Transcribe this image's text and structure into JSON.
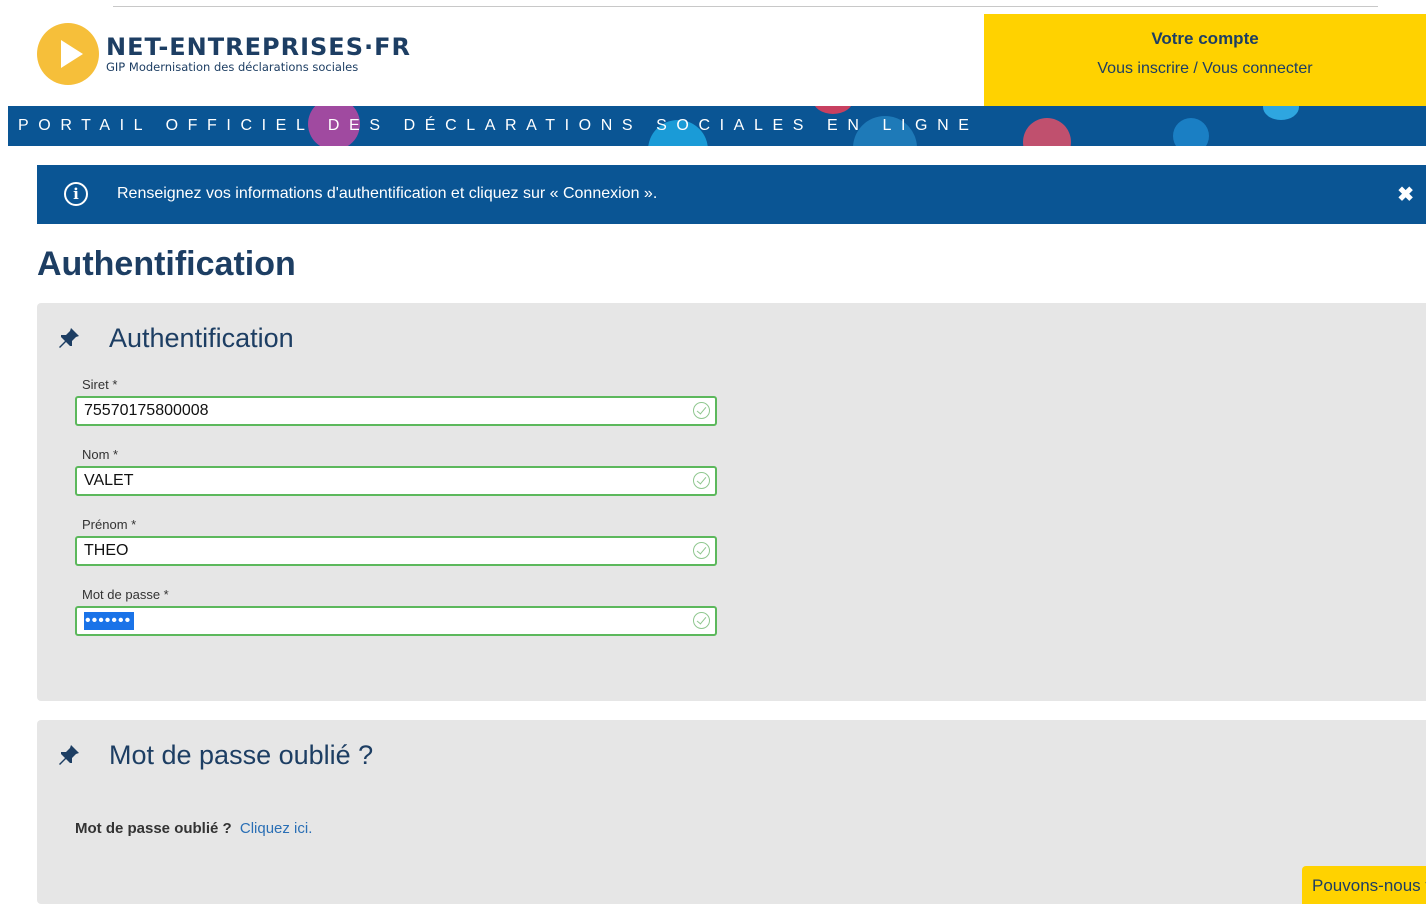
{
  "header": {
    "logo_name": "NET-ENTREPRISES·FR",
    "logo_sub": "GIP Modernisation des déclarations sociales",
    "account_title": "Votre compte",
    "account_link": "Vous inscrire / Vous connecter",
    "portal_tagline": "PORTAIL OFFICIEL DES DÉCLARATIONS SOCIALES EN LIGNE"
  },
  "banner": {
    "icon": "info-icon",
    "text": "Renseignez vos informations d'authentification et cliquez sur « Connexion ».",
    "close": "✖"
  },
  "page_title": "Authentification",
  "auth_panel": {
    "title": "Authentification",
    "icon": "pushpin-icon",
    "fields": [
      {
        "label": "Siret *",
        "value": "75570175800008"
      },
      {
        "label": "Nom *",
        "value": "VALET"
      },
      {
        "label": "Prénom *",
        "value": "THEO"
      },
      {
        "label": "Mot de passe *",
        "value": "•••••••"
      }
    ]
  },
  "pwd_panel": {
    "title": "Mot de passe oublié ?",
    "icon": "pushpin-icon",
    "question": "Mot de passe oublié ?",
    "link": "Cliquez ici."
  },
  "help_tab": "Pouvons-nous vous aider ?",
  "colors": {
    "brand_blue": "#0a5594",
    "accent_yellow": "#ffd200",
    "valid_green": "#5cb85c"
  }
}
